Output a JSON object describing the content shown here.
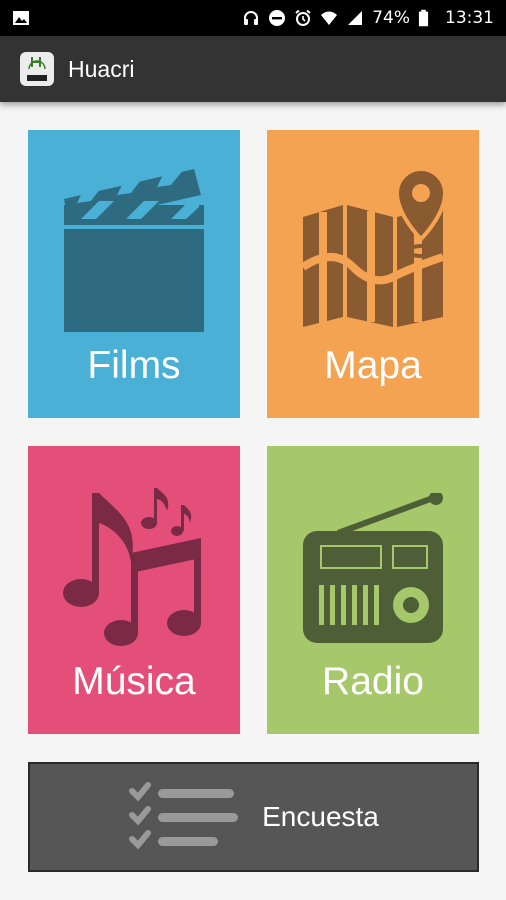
{
  "status_bar": {
    "battery": "74%",
    "time": "13:31",
    "icons": [
      "image-icon",
      "headphones-icon",
      "dnd-icon",
      "alarm-icon",
      "wifi-icon",
      "signal-icon",
      "battery-icon"
    ]
  },
  "app_bar": {
    "title": "Huacri",
    "logo_icon": "app-logo-icon"
  },
  "tiles": [
    {
      "label": "Films",
      "icon": "clapperboard-icon",
      "color": "#4ab0d6"
    },
    {
      "label": "Mapa",
      "icon": "map-icon",
      "color": "#f4a352"
    },
    {
      "label": "Música",
      "icon": "music-notes-icon",
      "color": "#e34f78"
    },
    {
      "label": "Radio",
      "icon": "radio-icon",
      "color": "#a6c86a"
    }
  ],
  "survey": {
    "label": "Encuesta",
    "icon": "checklist-icon",
    "color": "#565656"
  }
}
